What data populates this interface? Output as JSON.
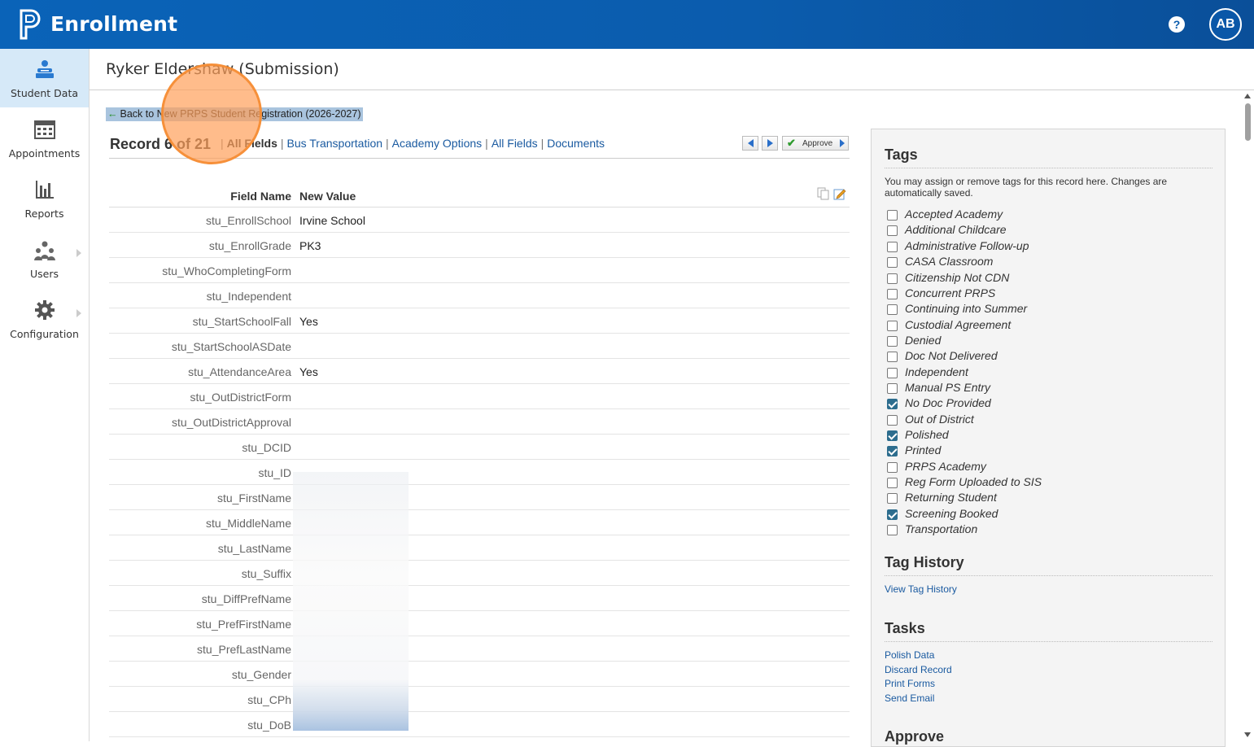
{
  "app": {
    "title": "Enrollment",
    "help_icon": "question-icon",
    "user_initials": "AB"
  },
  "colors": {
    "topbar": "#0b5cad",
    "accent": "#1a5aa0",
    "active_nav": "#d6e9f8",
    "checkbox_on": "#2d6d8e"
  },
  "sidebar": {
    "items": [
      {
        "label": "Student Data",
        "icon": "student-icon",
        "active": true
      },
      {
        "label": "Appointments",
        "icon": "calendar-icon"
      },
      {
        "label": "Reports",
        "icon": "bar-chart-icon"
      },
      {
        "label": "Users",
        "icon": "users-icon",
        "has_submenu": true
      },
      {
        "label": "Configuration",
        "icon": "gear-icon",
        "has_submenu": true
      }
    ]
  },
  "page": {
    "title": "Ryker Eldershaw (Submission)",
    "back_link": "Back to New PRPS Student Registration (2026-2027)"
  },
  "record": {
    "label": "Record 6 of 21",
    "tabs": [
      "All Fields",
      "Bus Transportation",
      "Academy Options",
      "All Fields",
      "Documents"
    ],
    "approve_label": "Approve"
  },
  "table": {
    "header_name": "Field Name",
    "header_value": "New Value",
    "rows": [
      {
        "name": "stu_EnrollSchool",
        "value": "Irvine School"
      },
      {
        "name": "stu_EnrollGrade",
        "value": "PK3"
      },
      {
        "name": "stu_WhoCompletingForm",
        "value": ""
      },
      {
        "name": "stu_Independent",
        "value": ""
      },
      {
        "name": "stu_StartSchoolFall",
        "value": "Yes"
      },
      {
        "name": "stu_StartSchoolASDate",
        "value": ""
      },
      {
        "name": "stu_AttendanceArea",
        "value": "Yes"
      },
      {
        "name": "stu_OutDistrictForm",
        "value": ""
      },
      {
        "name": "stu_OutDistrictApproval",
        "value": ""
      },
      {
        "name": "stu_DCID",
        "value": ""
      },
      {
        "name": "stu_ID",
        "value": ""
      },
      {
        "name": "stu_FirstName",
        "value": ""
      },
      {
        "name": "stu_MiddleName",
        "value": ""
      },
      {
        "name": "stu_LastName",
        "value": ""
      },
      {
        "name": "stu_Suffix",
        "value": ""
      },
      {
        "name": "stu_DiffPrefName",
        "value": ""
      },
      {
        "name": "stu_PrefFirstName",
        "value": ""
      },
      {
        "name": "stu_PrefLastName",
        "value": ""
      },
      {
        "name": "stu_Gender",
        "value": ""
      },
      {
        "name": "stu_CPh",
        "value": ""
      },
      {
        "name": "stu_DoB",
        "value": ""
      }
    ]
  },
  "tags": {
    "title": "Tags",
    "description": "You may assign or remove tags for this record here. Changes are automatically saved.",
    "items": [
      {
        "label": "Accepted Academy",
        "checked": false
      },
      {
        "label": "Additional Childcare",
        "checked": false
      },
      {
        "label": "Administrative Follow-up",
        "checked": false
      },
      {
        "label": "CASA Classroom",
        "checked": false
      },
      {
        "label": "Citizenship Not CDN",
        "checked": false
      },
      {
        "label": "Concurrent PRPS",
        "checked": false
      },
      {
        "label": "Continuing into Summer",
        "checked": false
      },
      {
        "label": "Custodial Agreement",
        "checked": false
      },
      {
        "label": "Denied",
        "checked": false
      },
      {
        "label": "Doc Not Delivered",
        "checked": false
      },
      {
        "label": "Independent",
        "checked": false
      },
      {
        "label": "Manual PS Entry",
        "checked": false
      },
      {
        "label": "No Doc Provided",
        "checked": true
      },
      {
        "label": "Out of District",
        "checked": false
      },
      {
        "label": "Polished",
        "checked": true
      },
      {
        "label": "Printed",
        "checked": true
      },
      {
        "label": "PRPS Academy",
        "checked": false
      },
      {
        "label": "Reg Form Uploaded to SIS",
        "checked": false
      },
      {
        "label": "Returning Student",
        "checked": false
      },
      {
        "label": "Screening Booked",
        "checked": true
      },
      {
        "label": "Transportation",
        "checked": false
      }
    ]
  },
  "tag_history": {
    "title": "Tag History",
    "link": "View Tag History"
  },
  "tasks": {
    "title": "Tasks",
    "links": [
      "Polish Data",
      "Discard Record",
      "Print Forms",
      "Send Email"
    ]
  },
  "approve_section": {
    "title": "Approve"
  }
}
